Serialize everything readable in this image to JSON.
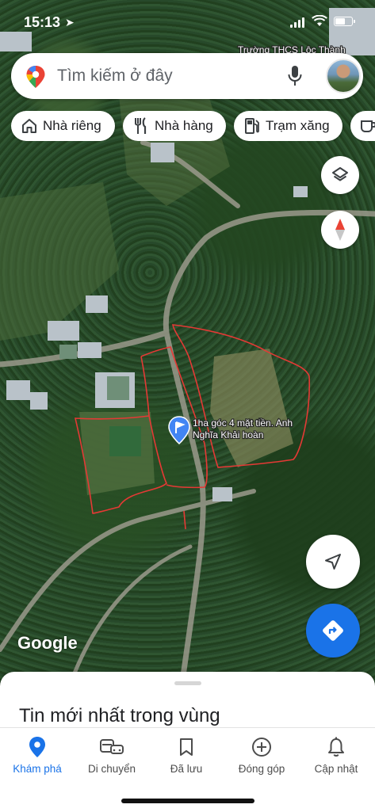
{
  "status_bar": {
    "time": "15:13"
  },
  "map": {
    "place_labels": [
      "Trường THCS Lộc Thành"
    ],
    "pin": {
      "icon": "flag-pin-icon",
      "color": "#4285f4",
      "label_line1": "1ha góc 4 mặt tiền. Anh",
      "label_line2": "Nghĩa Khải hoàn"
    },
    "annotation_color": "#e53935",
    "logo": "Google"
  },
  "search": {
    "placeholder": "Tìm kiếm ở đây",
    "pin_icon": "google-maps-pin-icon",
    "mic_icon": "microphone-icon",
    "avatar": "user-avatar"
  },
  "chips": [
    {
      "label": "Nhà riêng",
      "icon": "home-icon"
    },
    {
      "label": "Nhà hàng",
      "icon": "fork-knife-icon"
    },
    {
      "label": "Trạm xăng",
      "icon": "gas-station-icon"
    },
    {
      "label": "",
      "icon": "coffee-icon"
    }
  ],
  "controls": {
    "layers_icon": "layers-icon",
    "compass_icon": "compass-icon",
    "location_icon": "my-location-icon",
    "directions_icon": "directions-icon",
    "accent": "#1a73e8"
  },
  "sheet": {
    "title": "Tin mới nhất trong vùng"
  },
  "nav": [
    {
      "label": "Khám phá",
      "icon": "explore-pin-icon",
      "active": true
    },
    {
      "label": "Di chuyển",
      "icon": "commute-icon",
      "active": false
    },
    {
      "label": "Đã lưu",
      "icon": "bookmark-icon",
      "active": false
    },
    {
      "label": "Đóng góp",
      "icon": "add-circle-icon",
      "active": false
    },
    {
      "label": "Cập nhật",
      "icon": "bell-icon",
      "active": false
    }
  ]
}
